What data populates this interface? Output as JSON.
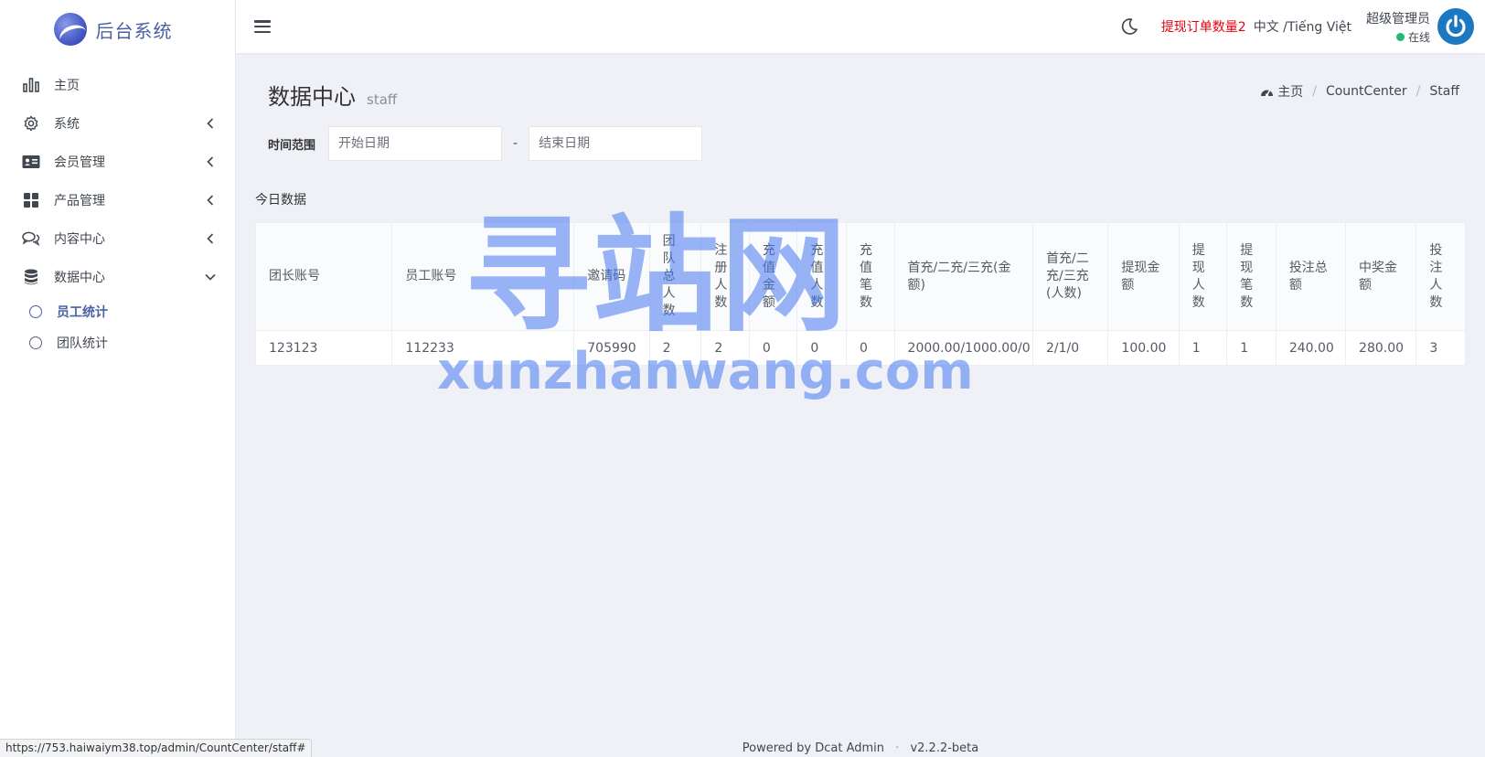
{
  "brand": {
    "title": "后台系统"
  },
  "sidebar": {
    "items": [
      {
        "label": "主页",
        "icon": "bar-chart-icon",
        "has_children": false
      },
      {
        "label": "系统",
        "icon": "gear-icon",
        "has_children": true,
        "expanded": false
      },
      {
        "label": "会员管理",
        "icon": "id-card-icon",
        "has_children": true,
        "expanded": false
      },
      {
        "label": "产品管理",
        "icon": "grid-icon",
        "has_children": true,
        "expanded": false
      },
      {
        "label": "内容中心",
        "icon": "chat-icon",
        "has_children": true,
        "expanded": false
      },
      {
        "label": "数据中心",
        "icon": "database-icon",
        "has_children": true,
        "expanded": true
      }
    ],
    "subitems": [
      {
        "label": "员工统计",
        "active": true
      },
      {
        "label": "团队统计",
        "active": false
      }
    ]
  },
  "header": {
    "withdraw_label": "提现订单数量2",
    "lang_label": "中文 /Tiếng Việt",
    "user_name": "超级管理员",
    "user_status": "在线",
    "colors": {
      "withdraw": "#e60012",
      "online": "#21b978",
      "avatar": "#1c78c0"
    }
  },
  "page": {
    "title": "数据中心",
    "subtitle": "staff",
    "breadcrumb": {
      "home": "主页",
      "items": [
        "CountCenter",
        "Staff"
      ]
    }
  },
  "filter": {
    "label": "时间范围",
    "start_placeholder": "开始日期",
    "end_placeholder": "结束日期",
    "separator": "-"
  },
  "section": {
    "label": "今日数据"
  },
  "table": {
    "columns": [
      "团长账号",
      "员工账号",
      "邀请码",
      "团队总人数",
      "注册人数",
      "充值金额",
      "充值人数",
      "充值笔数",
      "首充/二充/三充(金额)",
      "首充/二充/三充(人数)",
      "提现金额",
      "提现人数",
      "提现笔数",
      "投注总额",
      "中奖金额",
      "投注人数"
    ],
    "rows": [
      [
        "123123",
        "112233",
        "705990",
        "2",
        "2",
        "0",
        "0",
        "0",
        "2000.00/1000.00/0",
        "2/1/0",
        "100.00",
        "1",
        "1",
        "240.00",
        "280.00",
        "3"
      ]
    ]
  },
  "footer": {
    "powered": "Powered by Dcat Admin",
    "version": "v2.2.2-beta",
    "separator": "·"
  },
  "status_bar": {
    "url": "https://753.haiwaiym38.top/admin/CountCenter/staff#"
  },
  "watermark": {
    "big": "寻站网",
    "small": "xunzhanwang.com"
  },
  "accent_color": "#4c60a3"
}
